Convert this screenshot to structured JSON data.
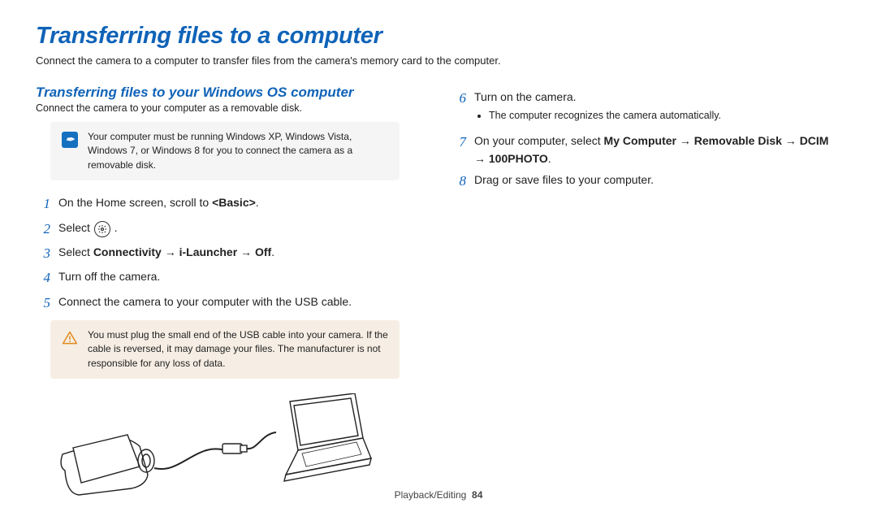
{
  "title": "Transferring files to a computer",
  "intro": "Connect the camera to a computer to transfer files from the camera's memory card to the computer.",
  "section_title": "Transferring files to your Windows OS computer",
  "section_sub": "Connect the camera to your computer as a removable disk.",
  "note_text": "Your computer must be running Windows XP, Windows Vista, Windows 7, or Windows 8 for you to connect the camera as a removable disk.",
  "steps_left": {
    "s1_a": "On the Home screen, scroll to ",
    "s1_b": "<Basic>",
    "s1_c": ".",
    "s2_a": "Select ",
    "s2_b": " .",
    "s3_a": "Select ",
    "s3_b": "Connectivity → i-Launcher → Off",
    "s3_c": ".",
    "s4": "Turn off the camera.",
    "s5": "Connect the camera to your computer with the USB cable."
  },
  "warn_text": "You must plug the small end of the USB cable into your camera. If the cable is reversed, it may damage your files. The manufacturer is not responsible for any loss of data.",
  "steps_right": {
    "s6": "Turn on the camera.",
    "s6_bullet": "The computer recognizes the camera automatically.",
    "s7_a": "On your computer, select ",
    "s7_b": "My Computer → Removable Disk → DCIM → 100PHOTO",
    "s7_c": ".",
    "s8": "Drag or save files to your computer."
  },
  "nums": {
    "n1": "1",
    "n2": "2",
    "n3": "3",
    "n4": "4",
    "n5": "5",
    "n6": "6",
    "n7": "7",
    "n8": "8"
  },
  "footer": {
    "section": "Playback/Editing",
    "page": "84"
  }
}
